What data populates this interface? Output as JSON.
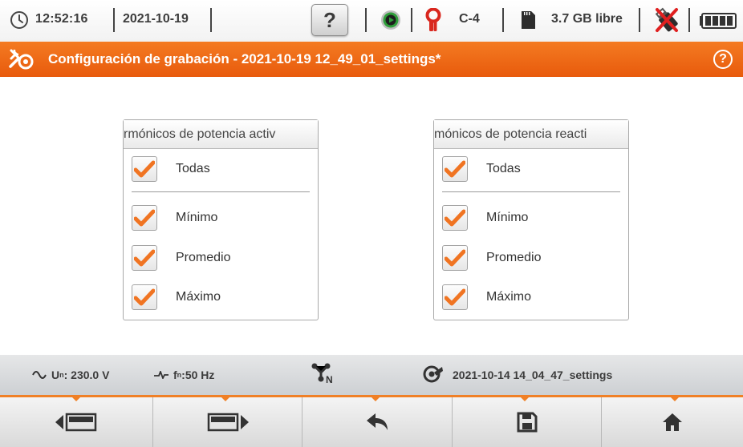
{
  "status_bar": {
    "time": "12:52:16",
    "date": "2021-10-19",
    "help_label": "?",
    "clamp_type": "C-4",
    "storage_free": "3.7 GB libre",
    "icons": [
      "clock-icon",
      "record-icon",
      "clamp-icon",
      "sd-card-icon",
      "usb-disconnected-icon",
      "battery-icon"
    ]
  },
  "title_bar": {
    "title": "Configuración de grabación - 2021-10-19 12_49_01_settings*",
    "help_label": "?"
  },
  "panels": {
    "left": {
      "header": "rmónicos de potencia activ",
      "all_label": "Todas",
      "options": [
        {
          "label": "Mínimo",
          "checked": true
        },
        {
          "label": "Promedio",
          "checked": true
        },
        {
          "label": "Máximo",
          "checked": true
        }
      ],
      "all_checked": true
    },
    "right": {
      "header": "mónicos de potencia reacti",
      "all_label": "Todas",
      "options": [
        {
          "label": "Mínimo",
          "checked": true
        },
        {
          "label": "Promedio",
          "checked": true
        },
        {
          "label": "Máximo",
          "checked": true
        }
      ],
      "all_checked": true
    }
  },
  "info_bar": {
    "nominal_voltage_prefix": "U",
    "nominal_voltage_sub": "n",
    "nominal_voltage_value": ": 230.0 V",
    "nominal_freq_prefix": "f",
    "nominal_freq_sub": "n",
    "nominal_freq_value": ":50 Hz",
    "network_sub": "N",
    "settings_file": "2021-10-14 14_04_47_settings"
  },
  "colors": {
    "accent_orange": "#f07a22",
    "check_orange": "#f07422",
    "record_green": "#2e9e3a",
    "clamp_red": "#d9271e"
  }
}
